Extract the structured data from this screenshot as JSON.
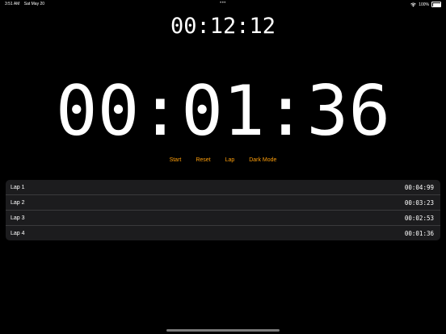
{
  "status_bar": {
    "time": "3:51 AM",
    "date": "Sat May 20",
    "center_dots": "•••",
    "battery_percent": "100%",
    "battery_level": 1.0,
    "icons": [
      "wifi-icon",
      "battery-icon"
    ]
  },
  "timer": {
    "total_time": "00:12:12",
    "current_lap_time": "00:01:36"
  },
  "controls": {
    "start_label": "Start",
    "reset_label": "Reset",
    "lap_label": "Lap",
    "dark_mode_label": "Dark Mode"
  },
  "laps": [
    {
      "label": "Lap 1",
      "time": "00:04:99"
    },
    {
      "label": "Lap 2",
      "time": "00:03:23"
    },
    {
      "label": "Lap 3",
      "time": "00:02:53"
    },
    {
      "label": "Lap 4",
      "time": "00:01:36"
    }
  ],
  "colors": {
    "background": "#000000",
    "accent": "#ff9f0a",
    "list_background": "#1c1c1e",
    "text": "#ffffff"
  }
}
